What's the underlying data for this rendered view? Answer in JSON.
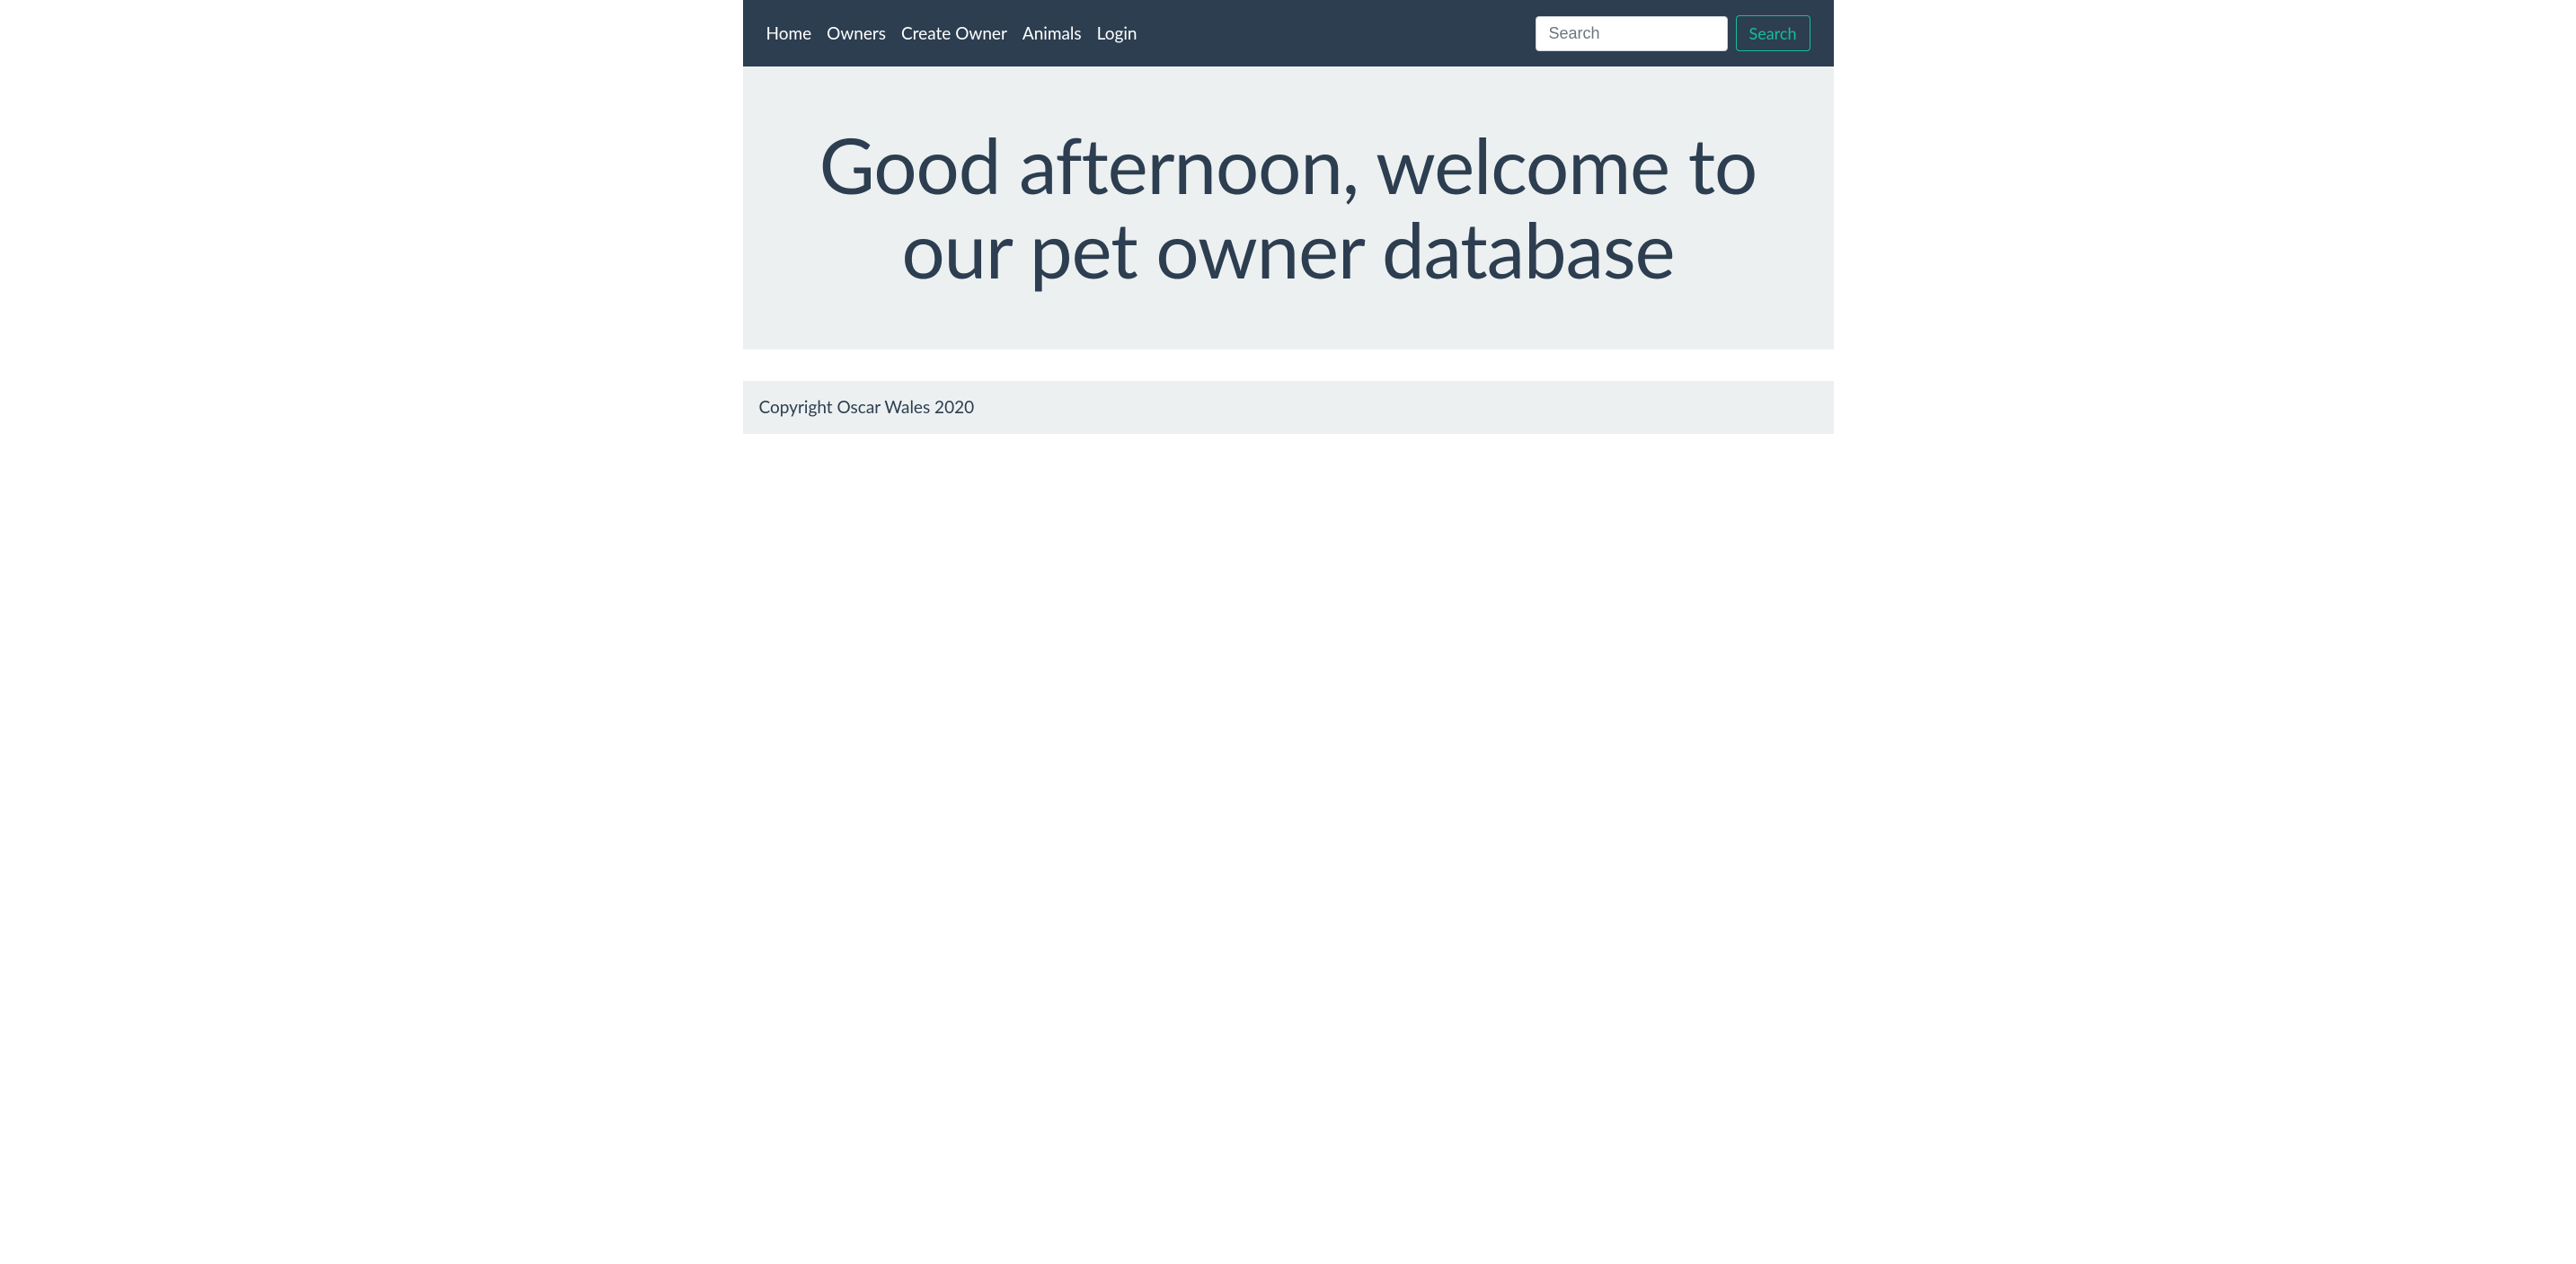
{
  "nav": {
    "links": [
      {
        "label": "Home"
      },
      {
        "label": "Owners"
      },
      {
        "label": "Create Owner"
      },
      {
        "label": "Animals"
      },
      {
        "label": "Login"
      }
    ]
  },
  "search": {
    "placeholder": "Search",
    "button_label": "Search"
  },
  "main": {
    "heading": "Good afternoon, welcome to our pet owner database"
  },
  "footer": {
    "text": "Copyright Oscar Wales 2020"
  }
}
